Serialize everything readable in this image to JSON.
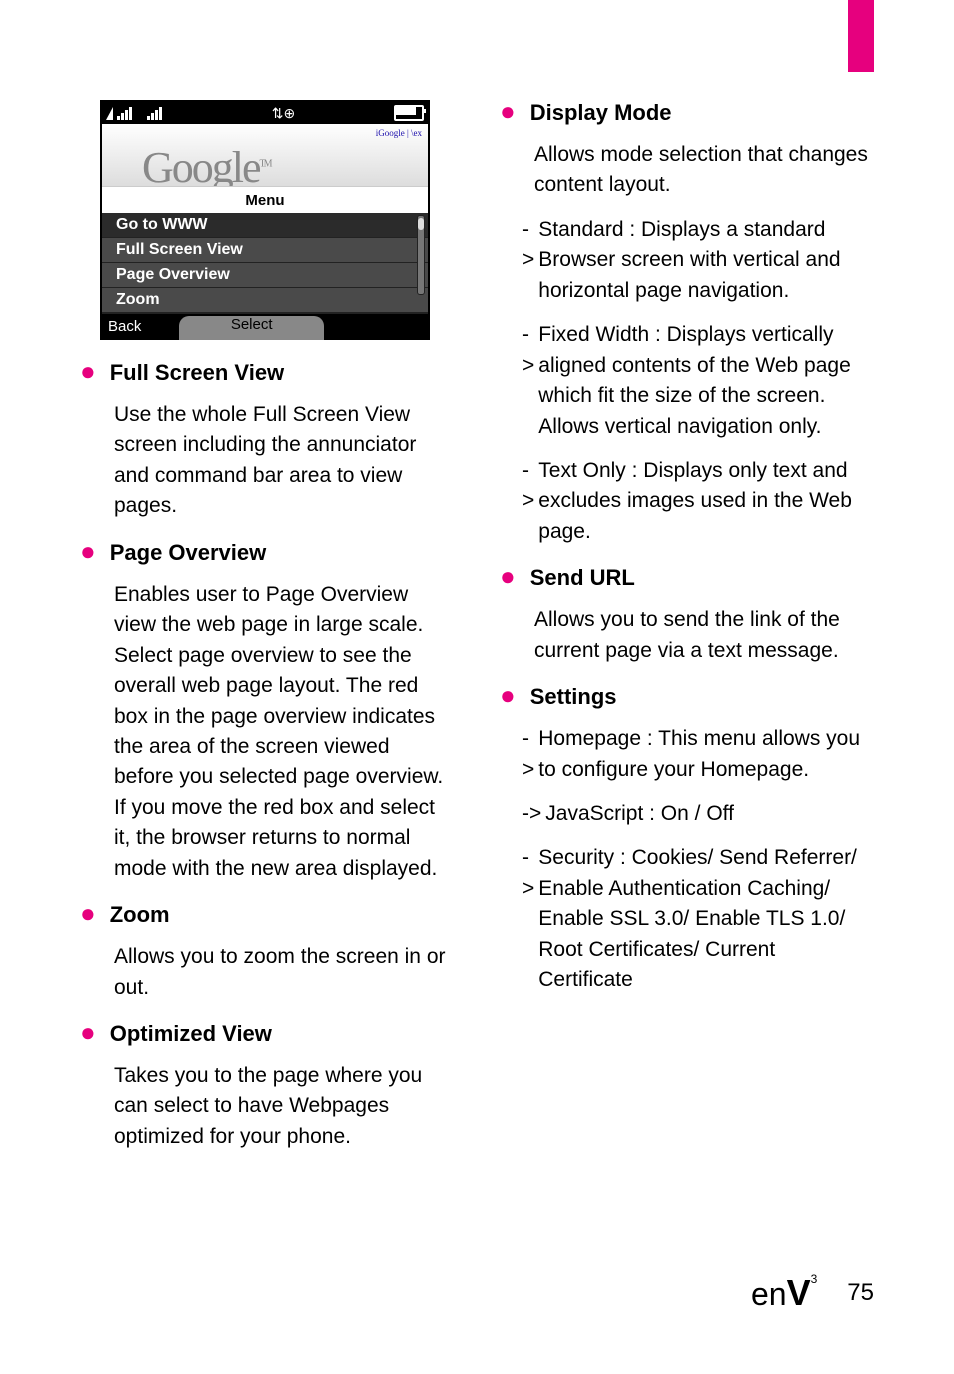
{
  "phone": {
    "browser_tab_text": "iGoogle  |  \\ex",
    "google_text": "Google",
    "tm": "TM",
    "menu_label": "Menu",
    "items": [
      "Go to WWW",
      "Full Screen View",
      "Page Overview",
      "Zoom"
    ],
    "cmd_left": "Back",
    "cmd_center": "Select"
  },
  "left": {
    "s1_title": "Full Screen View",
    "s1_body": "Use the whole Full Screen View screen including the annunciator and command bar area to view pages.",
    "s2_title": "Page Overview",
    "s2_body": "Enables user to Page Overview view the web page in large scale. Select page overview to see the overall web page layout. The red box in the page overview indicates the area of the screen viewed before you selected page overview. If you move the red box and select it, the browser returns to normal mode with the new area displayed.",
    "s3_title": "Zoom",
    "s3_body": "Allows you to zoom the screen in or out.",
    "s4_title": "Optimized View",
    "s4_body": "Takes you to the page where you can select to have Webpages optimized for your phone."
  },
  "right": {
    "d1_title": "Display Mode",
    "d1_body": "Allows mode selection that changes content layout.",
    "d1_a1_lead": "->",
    "d1_a1": "Standard : Displays a standard Browser screen with vertical and horizontal page navigation.",
    "d1_a2_lead": "->",
    "d1_a2": "Fixed Width :  Displays vertically aligned contents of the Web page which fit the size of the screen. Allows vertical navigation only.",
    "d1_a3_lead": "->",
    "d1_a3": "Text Only : Displays only text and excludes images used in the Web page.",
    "d2_title": "Send URL",
    "d2_body": "Allows you to send the link of the current page via a text message.",
    "d3_title": "Settings",
    "d3_a1_lead": "->",
    "d3_a1": "Homepage : This menu allows you to configure your Homepage.",
    "d3_a2_lead": "->",
    "d3_a2": "JavaScript : On / Off",
    "d3_a3_lead": "->",
    "d3_a3": "Security : Cookies/ Send Referrer/ Enable Authentication Caching/ Enable SSL 3.0/ Enable TLS 1.0/ Root Certificates/ Current Certificate"
  },
  "footer": {
    "logo_pre": "en",
    "logo_v": "V",
    "logo_sup": "3",
    "page": "75"
  }
}
